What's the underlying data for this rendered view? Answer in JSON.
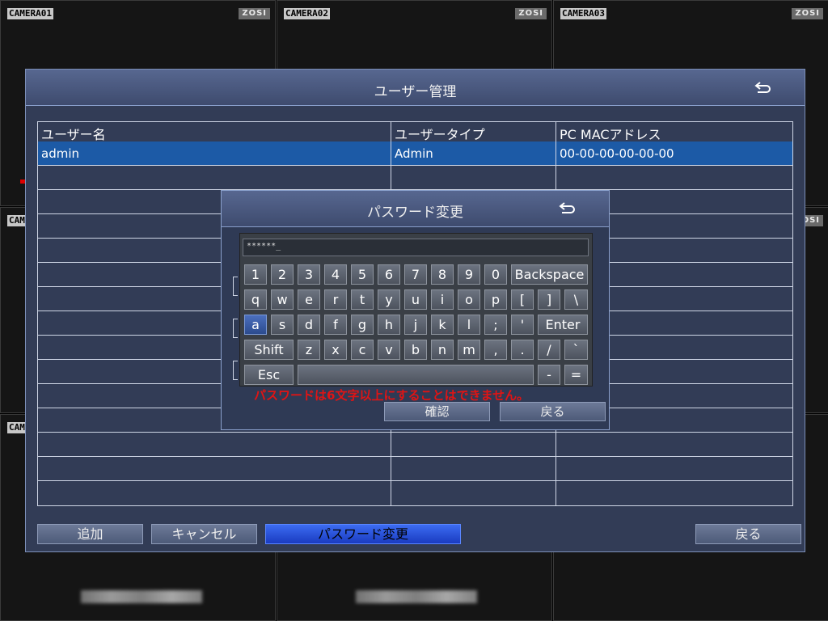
{
  "cameras": [
    {
      "label": "CAMERA01",
      "logo": "ZOSI"
    },
    {
      "label": "CAMERA02",
      "logo": "ZOSI"
    },
    {
      "label": "CAMERA03",
      "logo": "ZOSI"
    },
    {
      "label": "CAM",
      "logo": "ZOSI"
    },
    {
      "label": "CAM",
      "logo": ""
    }
  ],
  "window": {
    "title": "ユーザー管理",
    "back_icon": "return-arrow-icon"
  },
  "table": {
    "columns": [
      "ユーザー名",
      "ユーザータイプ",
      "PC MACアドレス"
    ],
    "rows": [
      {
        "name": "admin",
        "type": "Admin",
        "mac": "00-00-00-00-00-00"
      }
    ]
  },
  "buttons": {
    "add": "追加",
    "cancel": "キャンセル",
    "change_password": "パスワード変更",
    "back": "戻る"
  },
  "dialog": {
    "title": "パスワード変更",
    "password_value": "******_",
    "error": "パスワードは6文字以上にすることはできません。",
    "confirm": "確認",
    "back": "戻る"
  },
  "keyboard": {
    "row1": [
      "1",
      "2",
      "3",
      "4",
      "5",
      "6",
      "7",
      "8",
      "9",
      "0",
      "Backspace"
    ],
    "row2": [
      "q",
      "w",
      "e",
      "r",
      "t",
      "y",
      "u",
      "i",
      "o",
      "p",
      "[",
      "]",
      "\\"
    ],
    "row3": [
      "a",
      "s",
      "d",
      "f",
      "g",
      "h",
      "j",
      "k",
      "l",
      ";",
      "'",
      "Enter"
    ],
    "row4": [
      "Shift",
      "z",
      "x",
      "c",
      "v",
      "b",
      "n",
      "m",
      ",",
      ".",
      "/",
      "`"
    ],
    "row5": [
      "Esc",
      "",
      "-",
      "="
    ]
  },
  "colors": {
    "window_bg": "#323c56",
    "selected_row": "#1c5aa6",
    "active_button": "#1a3bc0",
    "error_text": "#e01414"
  }
}
